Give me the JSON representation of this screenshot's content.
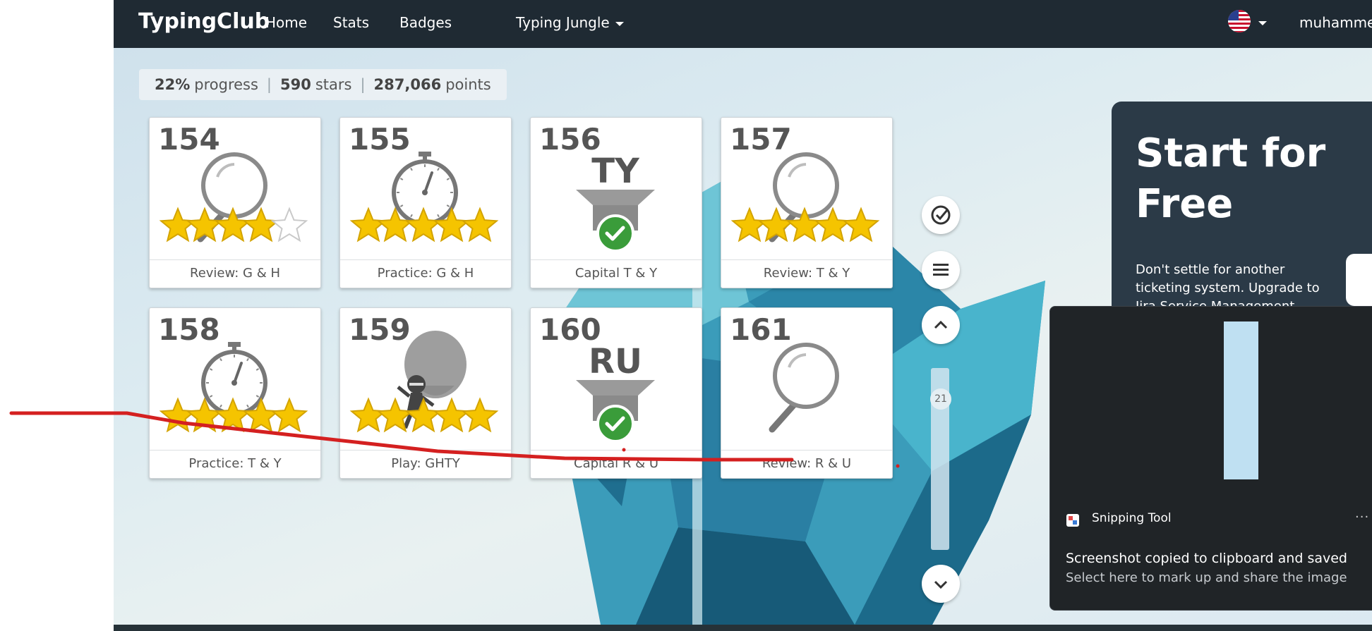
{
  "header": {
    "brand": "TypingClub",
    "nav": [
      "Home",
      "Stats",
      "Badges",
      "Typing Jungle"
    ],
    "username": "muhammed",
    "flag_icon": "us-flag-icon",
    "colors": {
      "bar": "#1f2a33",
      "text": "#ffffff"
    }
  },
  "progress": {
    "percent": "22%",
    "percent_label": "progress",
    "stars": "590",
    "stars_label": "stars",
    "points": "287,066",
    "points_label": "points",
    "separator": "|"
  },
  "lessons": [
    {
      "number": "154",
      "label": "Review: G & H",
      "type": "review",
      "stars": 4
    },
    {
      "number": "155",
      "label": "Practice: G & H",
      "type": "practice",
      "stars": 5
    },
    {
      "number": "156",
      "label": "Capital T & Y",
      "type": "capital",
      "letters": "TY",
      "stars": 0
    },
    {
      "number": "157",
      "label": "Review: T & Y",
      "type": "review",
      "stars": 5
    },
    {
      "number": "158",
      "label": "Practice: T & Y",
      "type": "practice",
      "stars": 5
    },
    {
      "number": "159",
      "label": "Play: GHTY",
      "type": "play",
      "stars": 5
    },
    {
      "number": "160",
      "label": "Capital R & U",
      "type": "capital",
      "letters": "RU",
      "stars": 0
    },
    {
      "number": "161",
      "label": "Review: R & U",
      "type": "review",
      "stars": 0
    }
  ],
  "side_controls": {
    "icons": [
      "check-circle-icon",
      "menu-icon",
      "chevron-up-icon",
      "chevron-down-icon"
    ],
    "scroll_badge": "21"
  },
  "ad": {
    "title": "Start for Free",
    "body": "Don't settle for another ticketing system. Upgrade to Jira Service Management.",
    "colors": {
      "panel": "#2b3a47"
    }
  },
  "toast": {
    "app_name": "Snipping Tool",
    "more": "···",
    "title": "Screenshot copied to clipboard and saved",
    "subtitle": "Select here to mark up and share the image"
  },
  "colors": {
    "ink": "#d42020",
    "star": "#f5c400"
  }
}
